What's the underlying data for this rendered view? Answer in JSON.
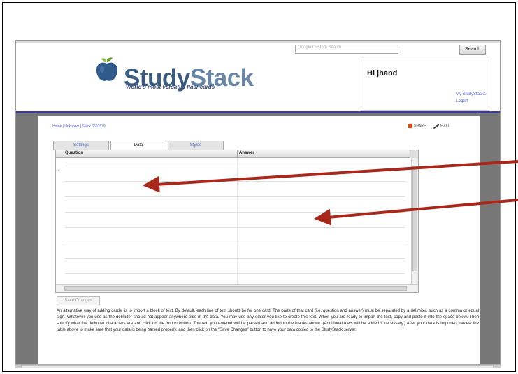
{
  "header": {
    "search_placeholder": "Google Custom Search",
    "search_button": "Search",
    "logo_study": "Study",
    "logo_stack": "Stack",
    "tagline": "World's most versatile flashcards",
    "greeting": "Hi jhand",
    "link_mystudystack": "My StudyStacks",
    "link_logoff": "Logoff"
  },
  "content": {
    "breadcrumb": "Home | Unknown | Stack 6601879",
    "share_label": "SHARE",
    "share_edit": "E-D-I"
  },
  "tabs": [
    {
      "label": "Settings",
      "active": false
    },
    {
      "label": "Data",
      "active": true
    },
    {
      "label": "Styles",
      "active": false
    }
  ],
  "grid": {
    "col_question": "Question",
    "col_answer": "Answer",
    "row_marker": "*"
  },
  "save_button": "Save Changes",
  "help_text": "An alternative way of adding cards, is to import a block of text. By default, each line of text should be for one card. The parts of that card (i.e. question and answer) must be separated by a delimiter, such as a comma or equal sign. Whatever you use as the delimiter should not appear anywhere else in the data. You may use any editor you like to create this text. When you are ready to import the text, copy and paste it into the space below. Then specify what the delimiter characters are and click on the Import button. The text you entered will be parsed and added to the blanks above. (Additional rows will be added if necessary.) After your data is imported, review the table above to make sure that your data is being parsed properly, and then click on the \"Save Changes\" button to have your data copied to the StudyStack server.",
  "colors": {
    "accent_navy": "#3b3b8f",
    "arrow_red": "#a8281c",
    "logo_blue": "#3a5a7e",
    "apple_blue": "#2f5a8a",
    "leaf_green": "#6a9a2a"
  }
}
